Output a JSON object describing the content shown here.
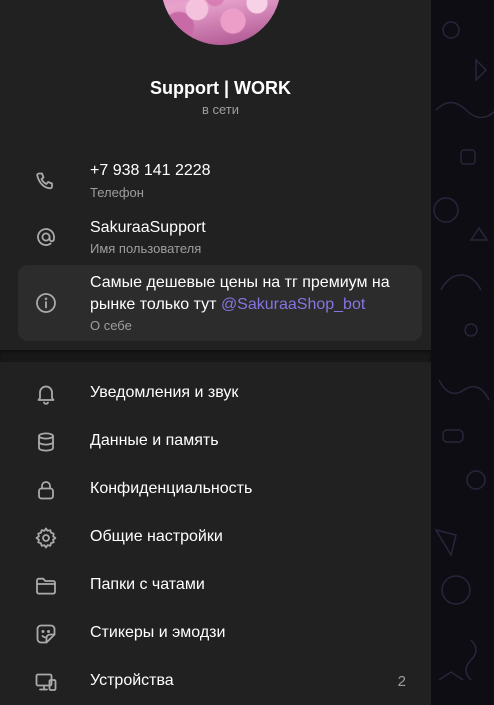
{
  "profile": {
    "name": "Support | WORK",
    "status": "в сети"
  },
  "info": {
    "phone": {
      "value": "+7 938 141 2228",
      "label": "Телефон",
      "icon": "phone-icon"
    },
    "username": {
      "value": "SakuraaSupport",
      "label": "Имя пользователя",
      "icon": "at-icon"
    },
    "bio": {
      "line1": "Самые дешевые цены на тг премиум на",
      "line2_text": "рынке только тут ",
      "mention": "@SakuraaShop_bot",
      "label": "О себе",
      "icon": "info-icon"
    }
  },
  "menu": [
    {
      "label": "Уведомления и звук",
      "icon": "bell-icon"
    },
    {
      "label": "Данные и память",
      "icon": "database-icon"
    },
    {
      "label": "Конфиденциальность",
      "icon": "lock-icon"
    },
    {
      "label": "Общие настройки",
      "icon": "gear-icon"
    },
    {
      "label": "Папки с чатами",
      "icon": "folder-icon"
    },
    {
      "label": "Стикеры и эмодзи",
      "icon": "sticker-icon"
    },
    {
      "label": "Устройства",
      "icon": "devices-icon",
      "badge": "2"
    }
  ],
  "colors": {
    "panel_bg": "#212121",
    "text_primary": "#ffffff",
    "text_secondary": "#9e9e9e",
    "accent": "#8774e1",
    "highlight_bg": "#2c2c2c"
  }
}
